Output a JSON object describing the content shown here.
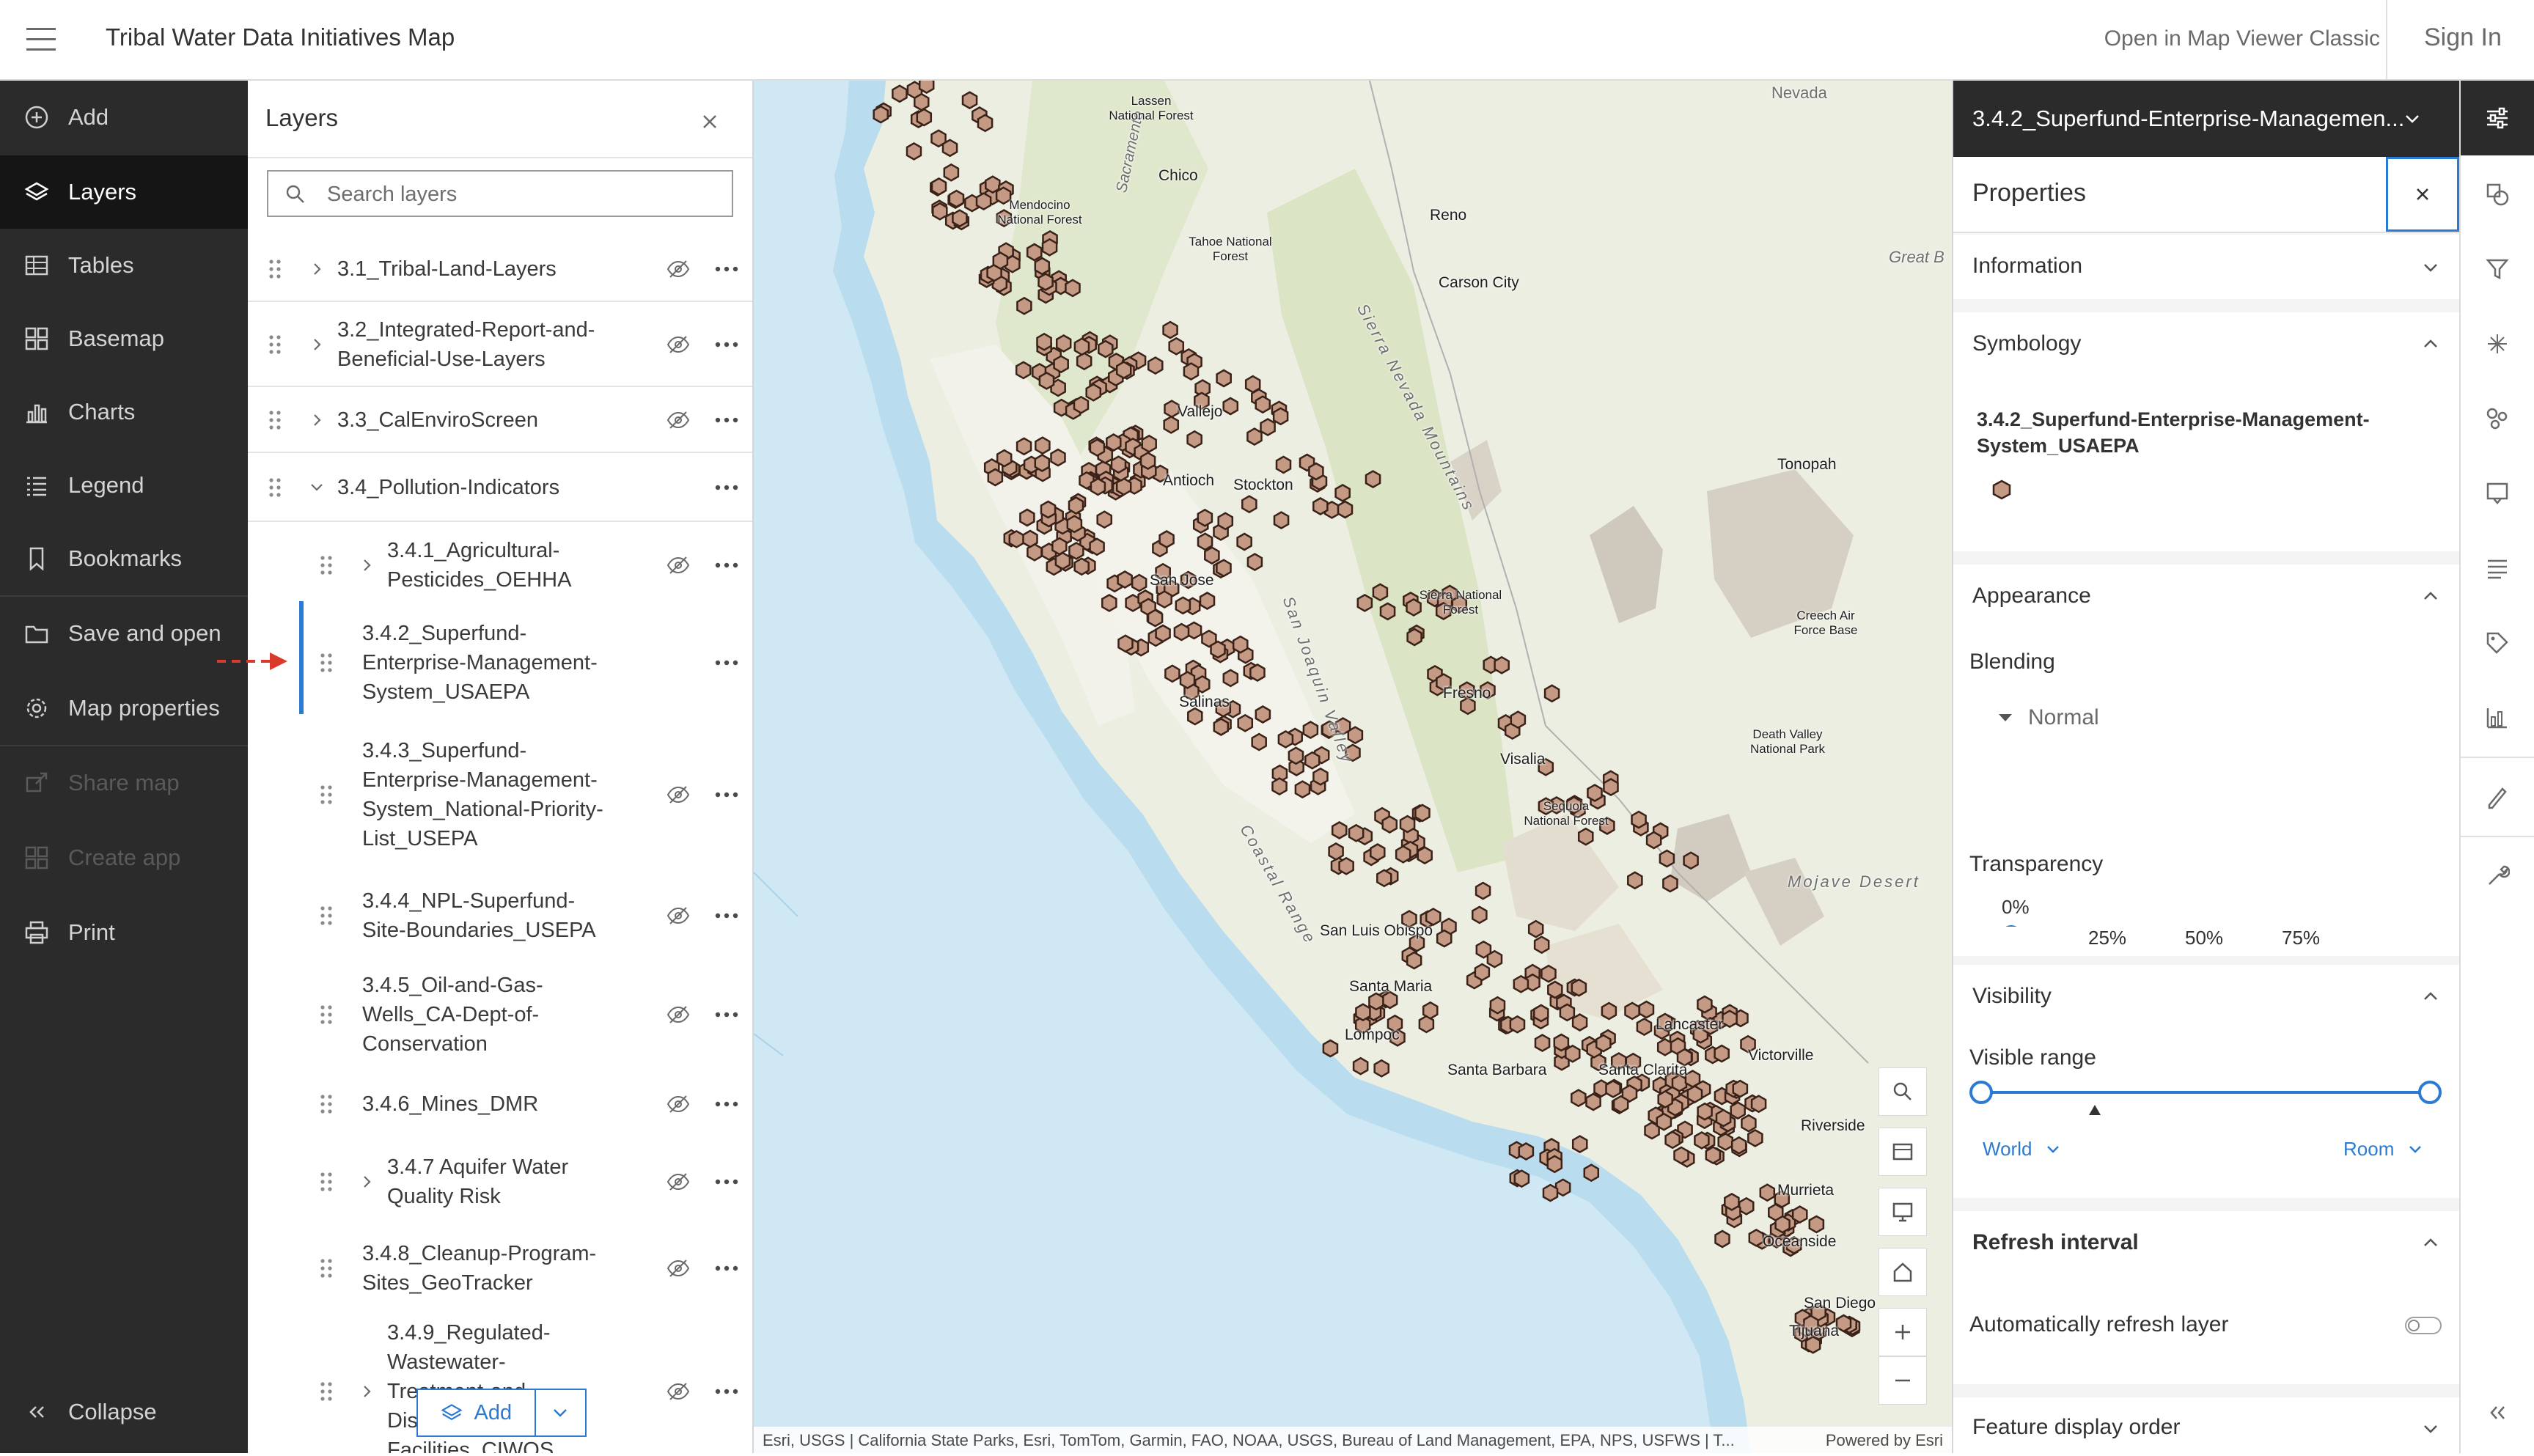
{
  "header": {
    "title": "Tribal Water Data Initiatives Map",
    "open_classic": "Open in Map Viewer Classic",
    "sign_in": "Sign In"
  },
  "nav": {
    "items": [
      {
        "label": "Add",
        "icon": "plus-circle-icon"
      },
      {
        "label": "Layers",
        "icon": "layers-icon"
      },
      {
        "label": "Tables",
        "icon": "table-icon"
      },
      {
        "label": "Basemap",
        "icon": "basemap-icon"
      },
      {
        "label": "Charts",
        "icon": "chart-icon"
      },
      {
        "label": "Legend",
        "icon": "legend-icon"
      },
      {
        "label": "Bookmarks",
        "icon": "bookmark-icon"
      },
      {
        "label": "Save and open",
        "icon": "folder-icon"
      },
      {
        "label": "Map properties",
        "icon": "gear-icon"
      },
      {
        "label": "Share map",
        "icon": "share-icon"
      },
      {
        "label": "Create app",
        "icon": "apps-icon"
      },
      {
        "label": "Print",
        "icon": "print-icon"
      }
    ],
    "collapse": "Collapse"
  },
  "layers": {
    "title": "Layers",
    "search_placeholder": "Search layers",
    "add_label": "Add",
    "items": [
      {
        "lines": [
          "3.1_Tribal-Land-Layers"
        ]
      },
      {
        "lines": [
          "3.2_Integrated-Report-and-",
          "Beneficial-Use-Layers"
        ]
      },
      {
        "lines": [
          "3.3_CalEnviroScreen"
        ]
      },
      {
        "lines": [
          "3.4_Pollution-Indicators"
        ]
      },
      {
        "lines": [
          "3.4.1_Agricultural-",
          "Pesticides_OEHHA"
        ]
      },
      {
        "lines": [
          "3.4.2_Superfund-",
          "Enterprise-Management-",
          "System_USAEPA"
        ]
      },
      {
        "lines": [
          "3.4.3_Superfund-",
          "Enterprise-Management-",
          "System_National-Priority-",
          "List_USEPA"
        ]
      },
      {
        "lines": [
          "3.4.4_NPL-Superfund-",
          "Site-Boundaries_USEPA"
        ]
      },
      {
        "lines": [
          "3.4.5_Oil-and-Gas-",
          "Wells_CA-Dept-of-",
          "Conservation"
        ]
      },
      {
        "lines": [
          "3.4.6_Mines_DMR"
        ]
      },
      {
        "lines": [
          "3.4.7 Aquifer Water",
          "Quality Risk"
        ]
      },
      {
        "lines": [
          "3.4.8_Cleanup-Program-",
          "Sites_GeoTracker"
        ]
      },
      {
        "lines": [
          "3.4.9_Regulated-",
          "Wastewater-",
          "Treatment-and-",
          "Dis",
          "Facilities_CIWQS"
        ]
      }
    ]
  },
  "map": {
    "places": [
      {
        "name": "Chico"
      },
      {
        "name": "Reno"
      },
      {
        "name": "Carson City"
      },
      {
        "name": "Stockton"
      },
      {
        "name": "Antioch"
      },
      {
        "name": "San Jose"
      },
      {
        "name": "Salinas"
      },
      {
        "name": "Fresno"
      },
      {
        "name": "Visalia"
      },
      {
        "name": "San Luis Obispo"
      },
      {
        "name": "Santa Maria"
      },
      {
        "name": "Lompoc"
      },
      {
        "name": "Santa Barbara"
      },
      {
        "name": "Santa Clarita"
      },
      {
        "name": "Lancaster"
      },
      {
        "name": "Victorville"
      },
      {
        "name": "Riverside"
      },
      {
        "name": "Murrieta"
      },
      {
        "name": "Oceanside"
      },
      {
        "name": "San Diego"
      },
      {
        "name": "Tijuana"
      },
      {
        "name": "Tonopah"
      },
      {
        "name": "Nevada"
      },
      {
        "name": "Great B"
      },
      {
        "name": "Mojave Desert"
      },
      {
        "name": "Sierra Nevada Mountains"
      },
      {
        "name": "Coastal Range"
      },
      {
        "name": "San Joaquin Valley"
      },
      {
        "name": "Sacramento"
      },
      {
        "name": "Vallejo"
      },
      {
        "name": "Lassen National Forest"
      },
      {
        "name": "Mendocino National Forest"
      },
      {
        "name": "Tahoe National Forest"
      },
      {
        "name": "Sierra National Forest"
      },
      {
        "name": "Sequoia National Forest"
      },
      {
        "name": "Death Valley National Park"
      },
      {
        "name": "Creech Air Force Base"
      }
    ],
    "attribution": "Esri, USGS | California State Parks, Esri, TomTom, Garmin, FAO, NOAA, USGS, Bureau of Land Management, EPA, NPS, USFWS | T...",
    "powered_by": "Powered by Esri"
  },
  "properties": {
    "layer_name": "3.4.2_Superfund-Enterprise-Managemen...",
    "title": "Properties",
    "information": "Information",
    "symbology": "Symbology",
    "symbology_layer_lines": [
      "3.4.2_Superfund-Enterprise-Management-",
      "System_USAEPA"
    ],
    "appearance": "Appearance",
    "blending_label": "Blending",
    "blending_value": "Normal",
    "transparency_label": "Transparency",
    "transparency_value": "0%",
    "ticks": [
      "25%",
      "50%",
      "75%"
    ],
    "visibility": "Visibility",
    "visible_range_label": "Visible range",
    "range_min": "World",
    "range_max": "Room",
    "refresh_interval": "Refresh interval",
    "auto_refresh_label": "Automatically refresh layer",
    "auto_refresh_on": false,
    "feature_display_order": "Feature display order"
  },
  "colors": {
    "accent": "#2b7bd3",
    "nav_bg": "#2b2b2b",
    "feature_fill": "#c49a85",
    "feature_stroke": "#3a2218"
  }
}
